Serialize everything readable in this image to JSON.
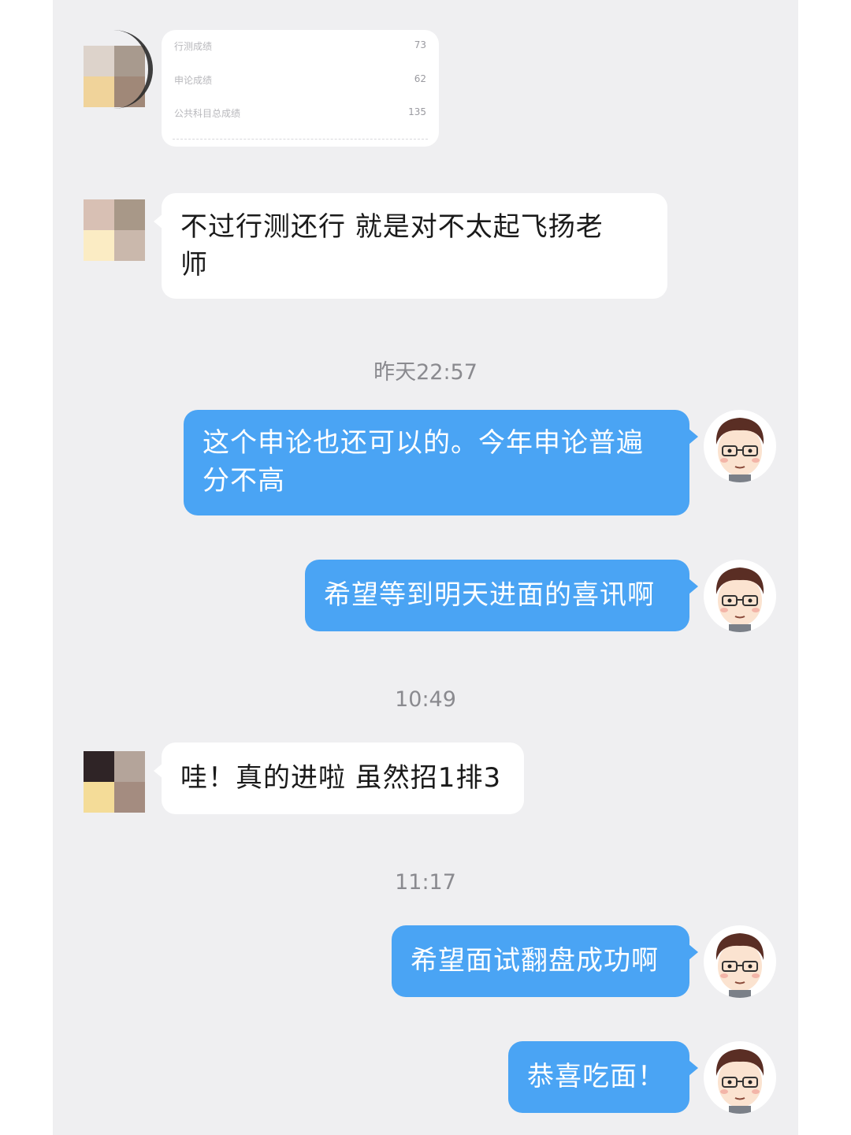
{
  "score_card": {
    "rows": [
      {
        "label": "行测成绩",
        "value": "73"
      },
      {
        "label": "申论成绩",
        "value": "62"
      },
      {
        "label": "公共科目总成绩",
        "value": "135"
      }
    ]
  },
  "messages": [
    {
      "side": "left",
      "text_line1": "不过行测还行 就是对不太起飞扬老",
      "text_line2": "师"
    },
    {
      "type": "time",
      "text": "昨天22:57"
    },
    {
      "side": "right",
      "text_line1": "这个申论也还可以的。今年申论普遍",
      "text_line2": "分不高"
    },
    {
      "side": "right",
      "text": "希望等到明天进面的喜讯啊"
    },
    {
      "type": "time",
      "text": "10:49"
    },
    {
      "side": "left",
      "text": "哇！真的进啦 虽然招1排3"
    },
    {
      "type": "time",
      "text": "11:17"
    },
    {
      "side": "right",
      "text": "希望面试翻盘成功啊"
    },
    {
      "side": "right",
      "text": "恭喜吃面！"
    }
  ],
  "colors": {
    "chat_background": "#efeff1",
    "outgoing_bubble": "#4aa4f4",
    "incoming_bubble": "#ffffff"
  }
}
